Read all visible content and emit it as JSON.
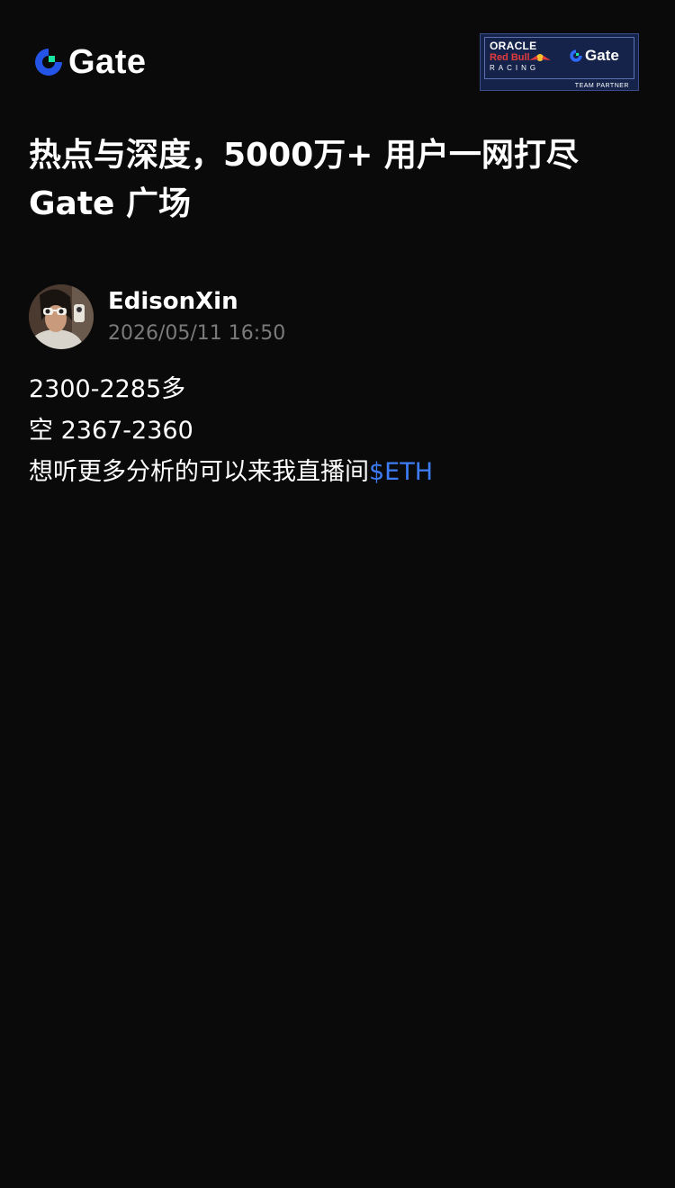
{
  "header": {
    "logo_text": "Gate",
    "partner_badge": {
      "oracle": "ORACLE",
      "red_bull": "Red Bull",
      "racing": "RACING",
      "gate": "Gate",
      "team_partner": "TEAM PARTNER"
    }
  },
  "headline": {
    "line1": "热点与深度，5000万+ 用户一网打尽",
    "line2": "Gate 广场"
  },
  "post": {
    "author_name": "EdisonXin",
    "timestamp": "2026/05/11 16:50",
    "lines": [
      "2300-2285多",
      "空  2367-2360",
      "想听更多分析的可以来我直播间"
    ],
    "ticker": "$ETH"
  },
  "colors": {
    "background": "#0a0a0a",
    "brand_blue": "#2354e6",
    "brand_green": "#17e5a1",
    "link_blue": "#3d7cf5",
    "muted_text": "#7a7a7a"
  }
}
